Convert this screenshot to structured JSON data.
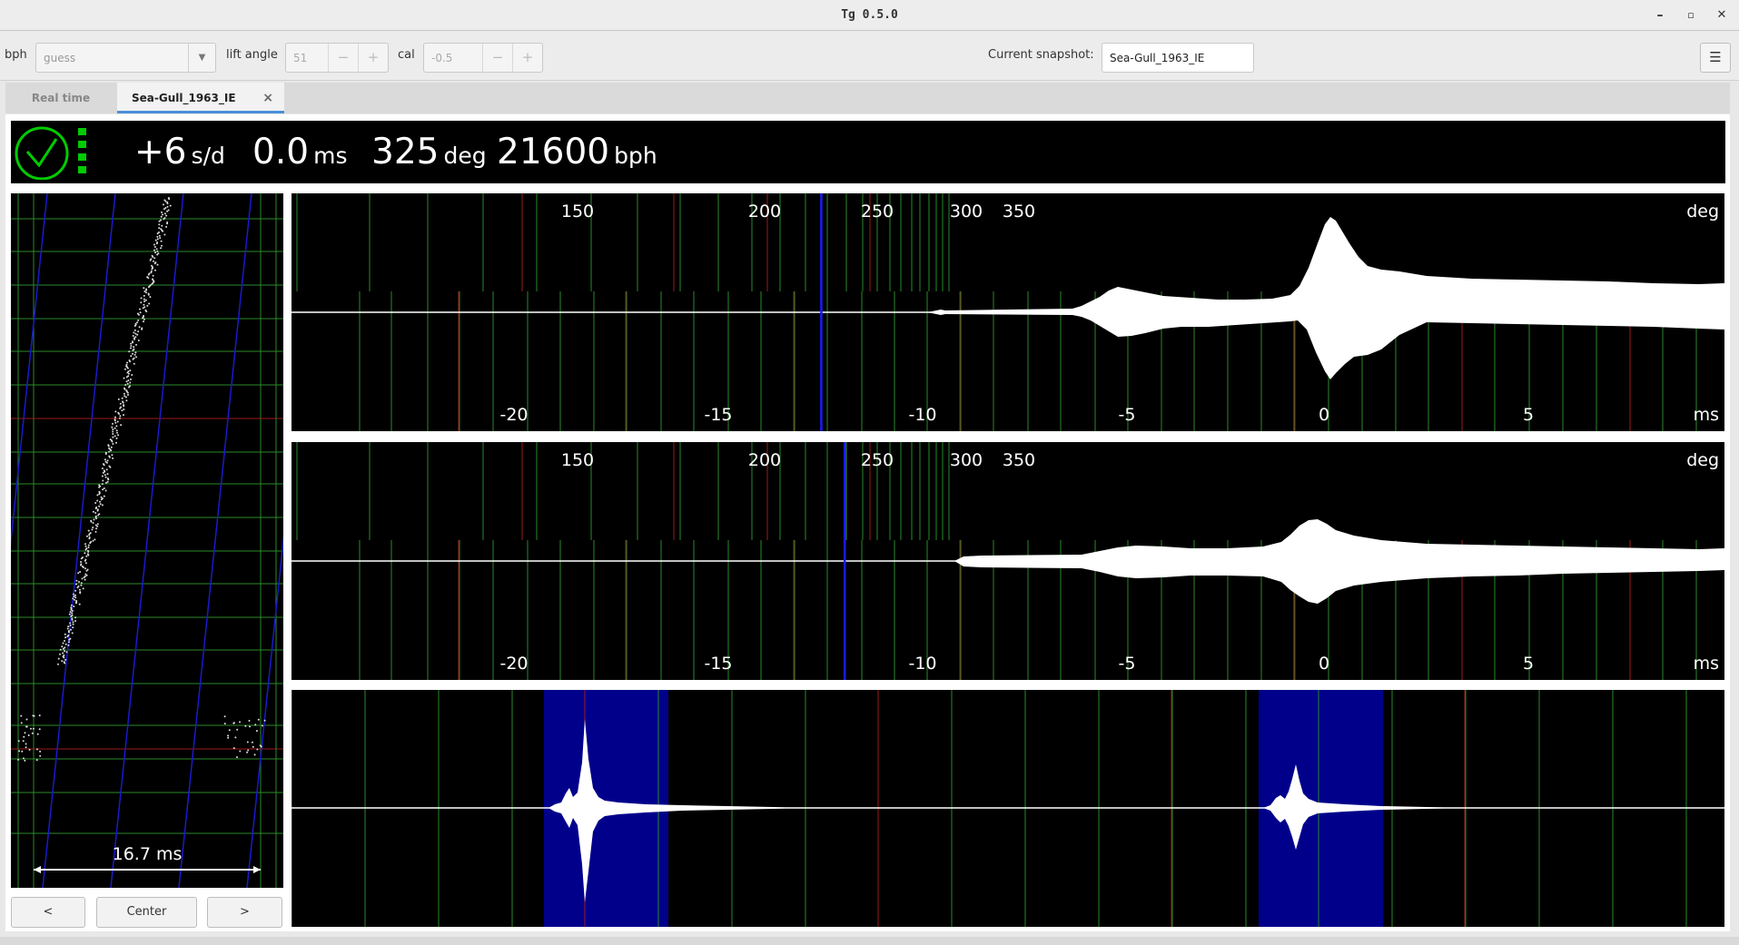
{
  "window": {
    "title": "Tg 0.5.0",
    "minimize_label": "–",
    "maximize_label": "▫",
    "close_label": "✕"
  },
  "toolbar": {
    "bph_label": "bph",
    "bph_value": "guess",
    "lift_angle_label": "lift angle",
    "lift_angle_value": "51",
    "cal_label": "cal",
    "cal_value": "-0.5",
    "minus": "−",
    "plus": "+",
    "snapshot_label": "Current snapshot:",
    "snapshot_value": "Sea-Gull_1963_IE",
    "menu_icon": "hamburger-menu-icon"
  },
  "tabs": [
    {
      "label": "Real time",
      "active": false
    },
    {
      "label": "Sea-Gull_1963_IE",
      "active": true,
      "close": "×"
    }
  ],
  "readout": {
    "rate_value": "+6",
    "rate_unit": "s/d",
    "beat_error_value": "0.0",
    "beat_error_unit": "ms",
    "amplitude_value": "325",
    "amplitude_unit": "deg",
    "bph_value": "21600",
    "bph_unit": "bph",
    "status_icon": "clock-check-icon",
    "signal_icon": "signal-level-icon",
    "signal_color": "#00cc00"
  },
  "paper": {
    "span_label": "16.7 ms"
  },
  "paper_buttons": {
    "left": "<",
    "center": "Center",
    "right": ">"
  },
  "tic_plot": {
    "deg_ticks": [
      "150",
      "200",
      "250",
      "300",
      "350"
    ],
    "deg_unit": "deg",
    "ms_ticks": [
      "-20",
      "-15",
      "-10",
      "-5",
      "0",
      "5"
    ],
    "ms_unit": "ms",
    "marker_ms": -9.2
  },
  "toc_plot": {
    "deg_ticks": [
      "150",
      "200",
      "250",
      "300",
      "350"
    ],
    "deg_unit": "deg",
    "ms_ticks": [
      "-20",
      "-15",
      "-10",
      "-5",
      "0",
      "5"
    ],
    "ms_unit": "ms",
    "marker_ms": -8.5
  },
  "colors": {
    "grid_green": "#2a8a2a",
    "grid_red": "#a01818",
    "marker_blue": "#1a1aff",
    "highlight_blue": "#00008b",
    "trace": "#ffffff"
  }
}
